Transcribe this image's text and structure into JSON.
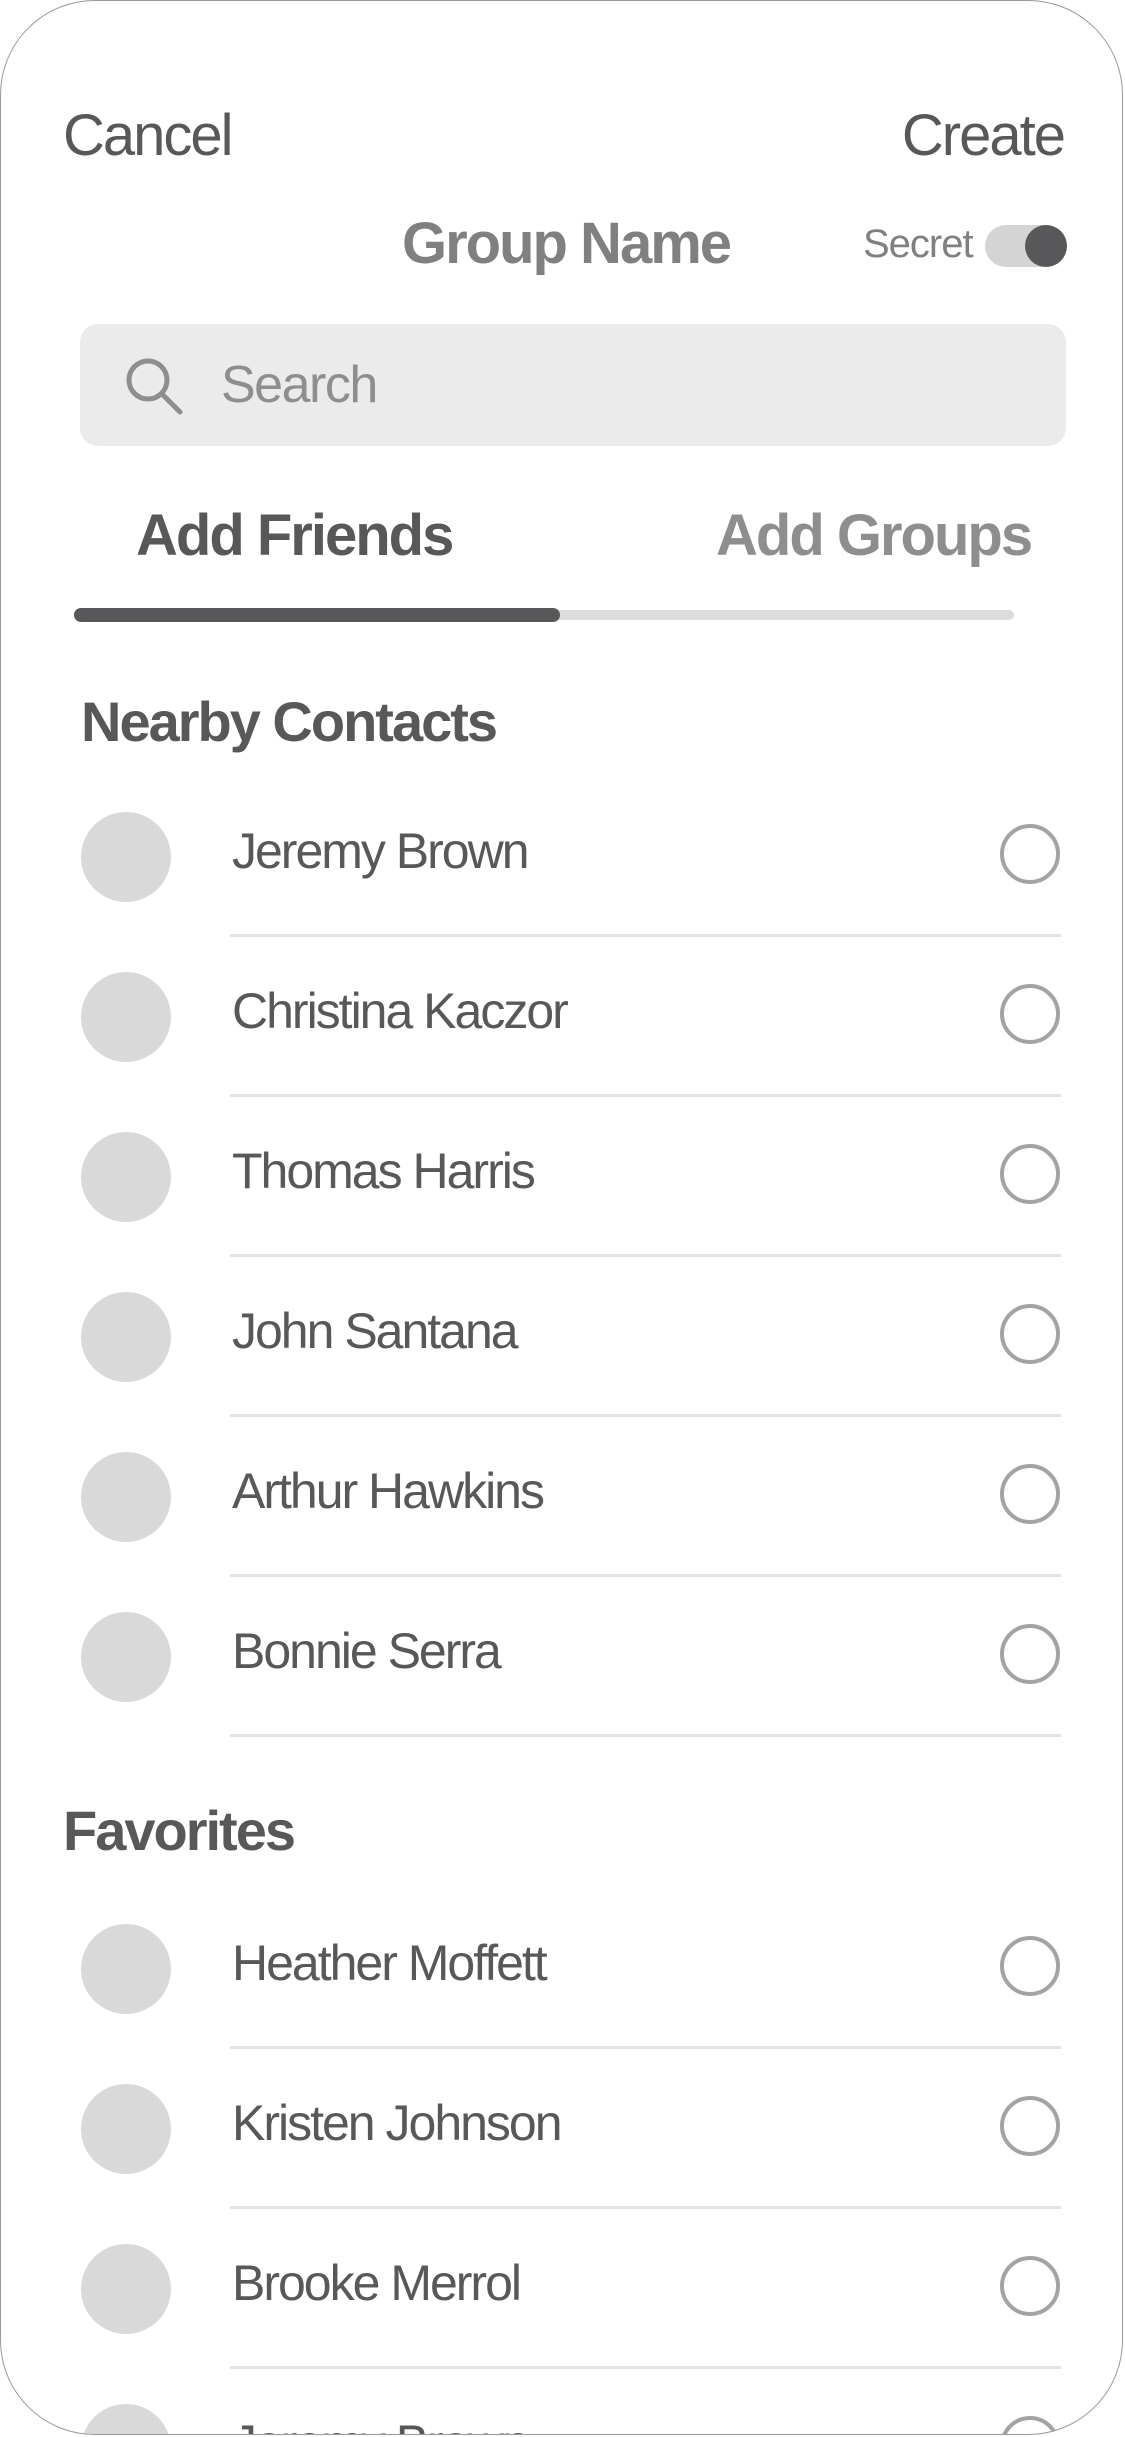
{
  "header": {
    "cancel_label": "Cancel",
    "create_label": "Create",
    "title": "Group Name",
    "secret_label": "Secret",
    "secret_enabled": true
  },
  "search": {
    "placeholder": "Search"
  },
  "tabs": [
    {
      "label": "Add Friends",
      "active": true
    },
    {
      "label": "Add Groups",
      "active": false
    }
  ],
  "sections": [
    {
      "title": "Nearby Contacts",
      "contacts": [
        {
          "name": "Jeremy Brown"
        },
        {
          "name": "Christina Kaczor"
        },
        {
          "name": "Thomas Harris"
        },
        {
          "name": "John Santana"
        },
        {
          "name": "Arthur Hawkins"
        },
        {
          "name": "Bonnie Serra"
        }
      ]
    },
    {
      "title": "Favorites",
      "contacts": [
        {
          "name": "Heather Moffett"
        },
        {
          "name": "Kristen Johnson"
        },
        {
          "name": "Brooke Merrol"
        },
        {
          "name": "Jeremy Brown"
        }
      ]
    }
  ],
  "colors": {
    "text": "#58585a",
    "muted": "#8e8e90",
    "avatar": "#d9d9d9",
    "search_bg": "#ebebeb"
  }
}
